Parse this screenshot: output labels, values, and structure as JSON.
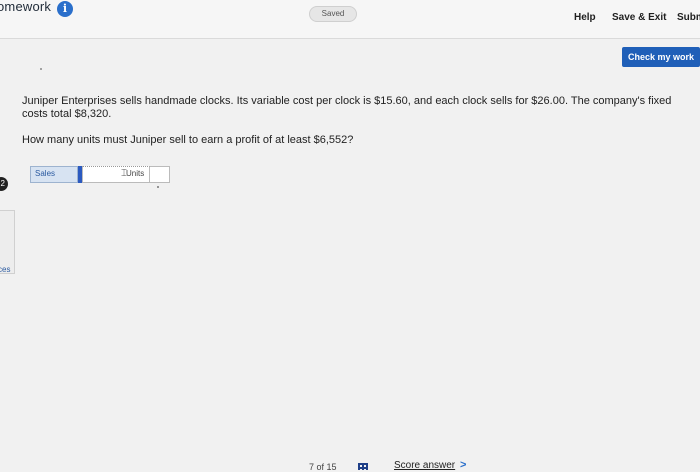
{
  "header": {
    "title": "omework",
    "saved_label": "Saved",
    "help_label": "Help",
    "save_exit_label": "Save & Exit",
    "submit_label": "Subm"
  },
  "toolbar": {
    "check_label": "Check my work"
  },
  "question": {
    "text": "Juniper Enterprises sells handmade clocks. Its variable cost per clock is $15.60, and each clock sells for $26.00. The company's fixed costs total $8,320.",
    "prompt": "How many units must Juniper sell to earn a profit of at least $6,552?"
  },
  "answer": {
    "row_label": "Sales",
    "input_value": "",
    "unit_label": "Units"
  },
  "sidebar": {
    "badge": "2",
    "label": "ces"
  },
  "footer": {
    "page_count": "7 of 15",
    "score_label": "Score answer",
    "chevron": ">"
  },
  "colors": {
    "accent": "#1f5fb8",
    "info_blue": "#2a6fcb"
  }
}
